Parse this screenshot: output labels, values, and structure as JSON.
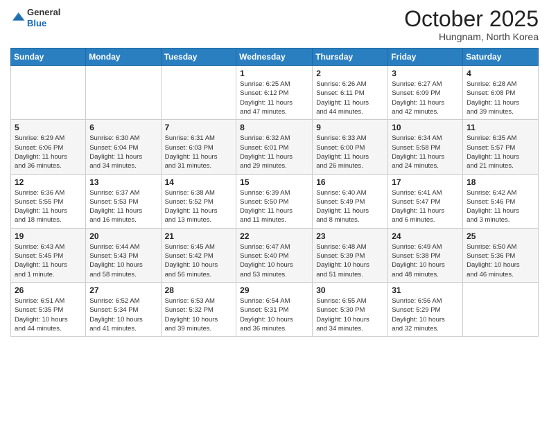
{
  "header": {
    "logo": {
      "line1": "General",
      "line2": "Blue"
    },
    "title": "October 2025",
    "location": "Hungnam, North Korea"
  },
  "weekdays": [
    "Sunday",
    "Monday",
    "Tuesday",
    "Wednesday",
    "Thursday",
    "Friday",
    "Saturday"
  ],
  "weeks": [
    [
      {
        "day": "",
        "detail": ""
      },
      {
        "day": "",
        "detail": ""
      },
      {
        "day": "",
        "detail": ""
      },
      {
        "day": "1",
        "detail": "Sunrise: 6:25 AM\nSunset: 6:12 PM\nDaylight: 11 hours\nand 47 minutes."
      },
      {
        "day": "2",
        "detail": "Sunrise: 6:26 AM\nSunset: 6:11 PM\nDaylight: 11 hours\nand 44 minutes."
      },
      {
        "day": "3",
        "detail": "Sunrise: 6:27 AM\nSunset: 6:09 PM\nDaylight: 11 hours\nand 42 minutes."
      },
      {
        "day": "4",
        "detail": "Sunrise: 6:28 AM\nSunset: 6:08 PM\nDaylight: 11 hours\nand 39 minutes."
      }
    ],
    [
      {
        "day": "5",
        "detail": "Sunrise: 6:29 AM\nSunset: 6:06 PM\nDaylight: 11 hours\nand 36 minutes."
      },
      {
        "day": "6",
        "detail": "Sunrise: 6:30 AM\nSunset: 6:04 PM\nDaylight: 11 hours\nand 34 minutes."
      },
      {
        "day": "7",
        "detail": "Sunrise: 6:31 AM\nSunset: 6:03 PM\nDaylight: 11 hours\nand 31 minutes."
      },
      {
        "day": "8",
        "detail": "Sunrise: 6:32 AM\nSunset: 6:01 PM\nDaylight: 11 hours\nand 29 minutes."
      },
      {
        "day": "9",
        "detail": "Sunrise: 6:33 AM\nSunset: 6:00 PM\nDaylight: 11 hours\nand 26 minutes."
      },
      {
        "day": "10",
        "detail": "Sunrise: 6:34 AM\nSunset: 5:58 PM\nDaylight: 11 hours\nand 24 minutes."
      },
      {
        "day": "11",
        "detail": "Sunrise: 6:35 AM\nSunset: 5:57 PM\nDaylight: 11 hours\nand 21 minutes."
      }
    ],
    [
      {
        "day": "12",
        "detail": "Sunrise: 6:36 AM\nSunset: 5:55 PM\nDaylight: 11 hours\nand 18 minutes."
      },
      {
        "day": "13",
        "detail": "Sunrise: 6:37 AM\nSunset: 5:53 PM\nDaylight: 11 hours\nand 16 minutes."
      },
      {
        "day": "14",
        "detail": "Sunrise: 6:38 AM\nSunset: 5:52 PM\nDaylight: 11 hours\nand 13 minutes."
      },
      {
        "day": "15",
        "detail": "Sunrise: 6:39 AM\nSunset: 5:50 PM\nDaylight: 11 hours\nand 11 minutes."
      },
      {
        "day": "16",
        "detail": "Sunrise: 6:40 AM\nSunset: 5:49 PM\nDaylight: 11 hours\nand 8 minutes."
      },
      {
        "day": "17",
        "detail": "Sunrise: 6:41 AM\nSunset: 5:47 PM\nDaylight: 11 hours\nand 6 minutes."
      },
      {
        "day": "18",
        "detail": "Sunrise: 6:42 AM\nSunset: 5:46 PM\nDaylight: 11 hours\nand 3 minutes."
      }
    ],
    [
      {
        "day": "19",
        "detail": "Sunrise: 6:43 AM\nSunset: 5:45 PM\nDaylight: 11 hours\nand 1 minute."
      },
      {
        "day": "20",
        "detail": "Sunrise: 6:44 AM\nSunset: 5:43 PM\nDaylight: 10 hours\nand 58 minutes."
      },
      {
        "day": "21",
        "detail": "Sunrise: 6:45 AM\nSunset: 5:42 PM\nDaylight: 10 hours\nand 56 minutes."
      },
      {
        "day": "22",
        "detail": "Sunrise: 6:47 AM\nSunset: 5:40 PM\nDaylight: 10 hours\nand 53 minutes."
      },
      {
        "day": "23",
        "detail": "Sunrise: 6:48 AM\nSunset: 5:39 PM\nDaylight: 10 hours\nand 51 minutes."
      },
      {
        "day": "24",
        "detail": "Sunrise: 6:49 AM\nSunset: 5:38 PM\nDaylight: 10 hours\nand 48 minutes."
      },
      {
        "day": "25",
        "detail": "Sunrise: 6:50 AM\nSunset: 5:36 PM\nDaylight: 10 hours\nand 46 minutes."
      }
    ],
    [
      {
        "day": "26",
        "detail": "Sunrise: 6:51 AM\nSunset: 5:35 PM\nDaylight: 10 hours\nand 44 minutes."
      },
      {
        "day": "27",
        "detail": "Sunrise: 6:52 AM\nSunset: 5:34 PM\nDaylight: 10 hours\nand 41 minutes."
      },
      {
        "day": "28",
        "detail": "Sunrise: 6:53 AM\nSunset: 5:32 PM\nDaylight: 10 hours\nand 39 minutes."
      },
      {
        "day": "29",
        "detail": "Sunrise: 6:54 AM\nSunset: 5:31 PM\nDaylight: 10 hours\nand 36 minutes."
      },
      {
        "day": "30",
        "detail": "Sunrise: 6:55 AM\nSunset: 5:30 PM\nDaylight: 10 hours\nand 34 minutes."
      },
      {
        "day": "31",
        "detail": "Sunrise: 6:56 AM\nSunset: 5:29 PM\nDaylight: 10 hours\nand 32 minutes."
      },
      {
        "day": "",
        "detail": ""
      }
    ]
  ]
}
